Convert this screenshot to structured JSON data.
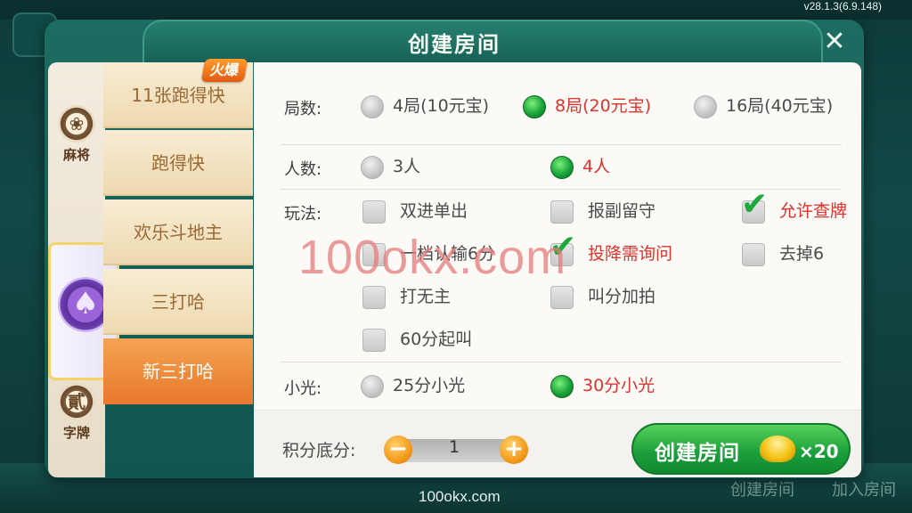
{
  "version": "v28.1.3(6.9.148)",
  "dialog": {
    "title": "创建房间",
    "close_icon": "close-icon"
  },
  "categories": [
    {
      "label": "麻将",
      "icon": "mahjong-icon"
    },
    {
      "label": "",
      "icon": "spade-icon"
    },
    {
      "label": "字牌",
      "icon": "zipai-icon"
    }
  ],
  "games": [
    {
      "label": "11张跑得快"
    },
    {
      "label": "跑得快"
    },
    {
      "label": "欢乐斗地主"
    },
    {
      "label": "三打哈"
    },
    {
      "label": "新三打哈"
    }
  ],
  "hot_badge": "火爆",
  "rounds": {
    "label": "局数:",
    "options": [
      {
        "label": "4局(10元宝)",
        "selected": false
      },
      {
        "label": "8局(20元宝)",
        "selected": true
      },
      {
        "label": "16局(40元宝)",
        "selected": false
      }
    ]
  },
  "players": {
    "label": "人数:",
    "options": [
      {
        "label": "3人",
        "selected": false
      },
      {
        "label": "4人",
        "selected": true
      }
    ]
  },
  "rules": {
    "label": "玩法:",
    "options": [
      {
        "label": "双进单出",
        "checked": false
      },
      {
        "label": "报副留守",
        "checked": false
      },
      {
        "label": "允许查牌",
        "checked": true
      },
      {
        "label": "一档认输6分",
        "checked": false
      },
      {
        "label": "投降需询问",
        "checked": true
      },
      {
        "label": "去掉6",
        "checked": false
      },
      {
        "label": "打无主",
        "checked": false
      },
      {
        "label": "叫分加拍",
        "checked": false
      },
      {
        "label": "60分起叫",
        "checked": false
      }
    ]
  },
  "xiaoguang": {
    "label": "小光:",
    "options": [
      {
        "label": "25分小光",
        "selected": false
      },
      {
        "label": "30分小光",
        "selected": true
      }
    ]
  },
  "score": {
    "label": "积分底分:",
    "value": "1",
    "minus": "−",
    "plus": "+"
  },
  "create_button": {
    "label": "创建房间",
    "cost": "×20",
    "icon": "gold-ingot-icon"
  },
  "watermark": "100okx.com",
  "bottom": {
    "url": "100okx.com",
    "create_room": "创建房间",
    "join_room": "加入房间"
  },
  "colors": {
    "selected_text": "#e0322b",
    "accent_green": "#1a9e3a",
    "active_game": "#e8792b"
  }
}
